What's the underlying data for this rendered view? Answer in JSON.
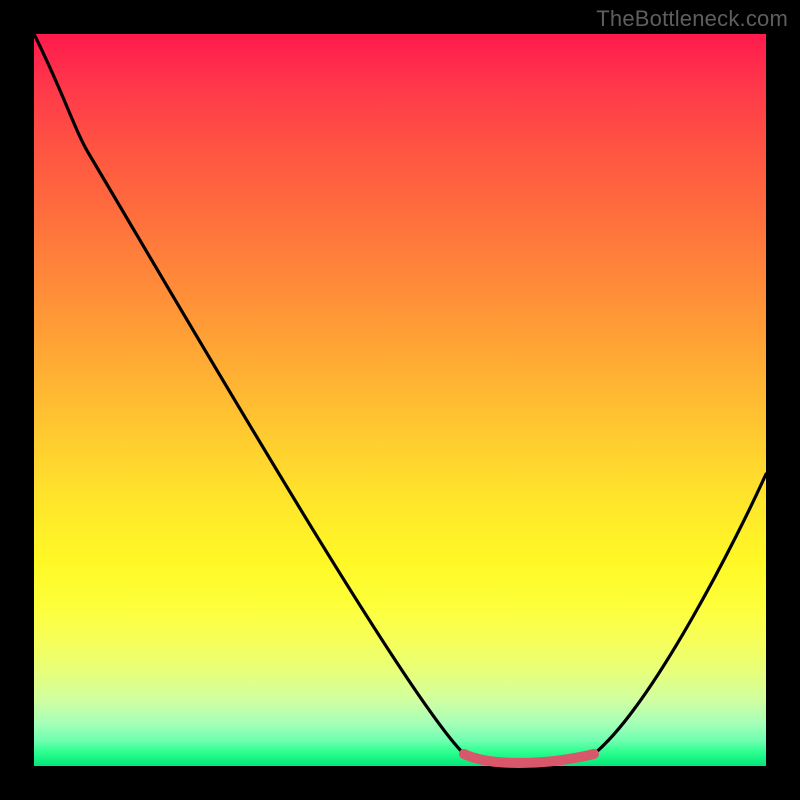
{
  "attribution": "TheBottleneck.com",
  "colors": {
    "frame": "#000000",
    "gradient_top": "#ff1a4d",
    "gradient_bottom": "#00e878",
    "curve": "#000000",
    "highlight": "#d9576b",
    "attribution_text": "#5e5e5e"
  },
  "chart_data": {
    "type": "line",
    "title": "",
    "xlabel": "",
    "ylabel": "",
    "x_range": [
      0,
      100
    ],
    "y_range": [
      0,
      100
    ],
    "grid": false,
    "legend_position": "none",
    "series": [
      {
        "name": "bottleneck-curve",
        "x": [
          0,
          4,
          8,
          15,
          25,
          40,
          55,
          59,
          63,
          70,
          76,
          80,
          85,
          92,
          97,
          100
        ],
        "y": [
          100,
          92,
          85,
          72,
          55,
          30,
          10,
          2,
          0,
          0,
          0,
          2,
          10,
          24,
          35,
          40
        ],
        "color": "#000000"
      },
      {
        "name": "highlight-valley",
        "x": [
          59,
          63,
          70,
          76
        ],
        "y": [
          2,
          0,
          0,
          2
        ],
        "color": "#d9576b"
      }
    ],
    "annotations": [
      {
        "text": "TheBottleneck.com",
        "position": "top-right"
      }
    ],
    "background_gradient": {
      "direction": "vertical",
      "stops": [
        {
          "pos": 0.0,
          "color": "#ff1a4d"
        },
        {
          "pos": 0.5,
          "color": "#ffce2f"
        },
        {
          "pos": 0.8,
          "color": "#feff3a"
        },
        {
          "pos": 1.0,
          "color": "#00e878"
        }
      ]
    }
  }
}
